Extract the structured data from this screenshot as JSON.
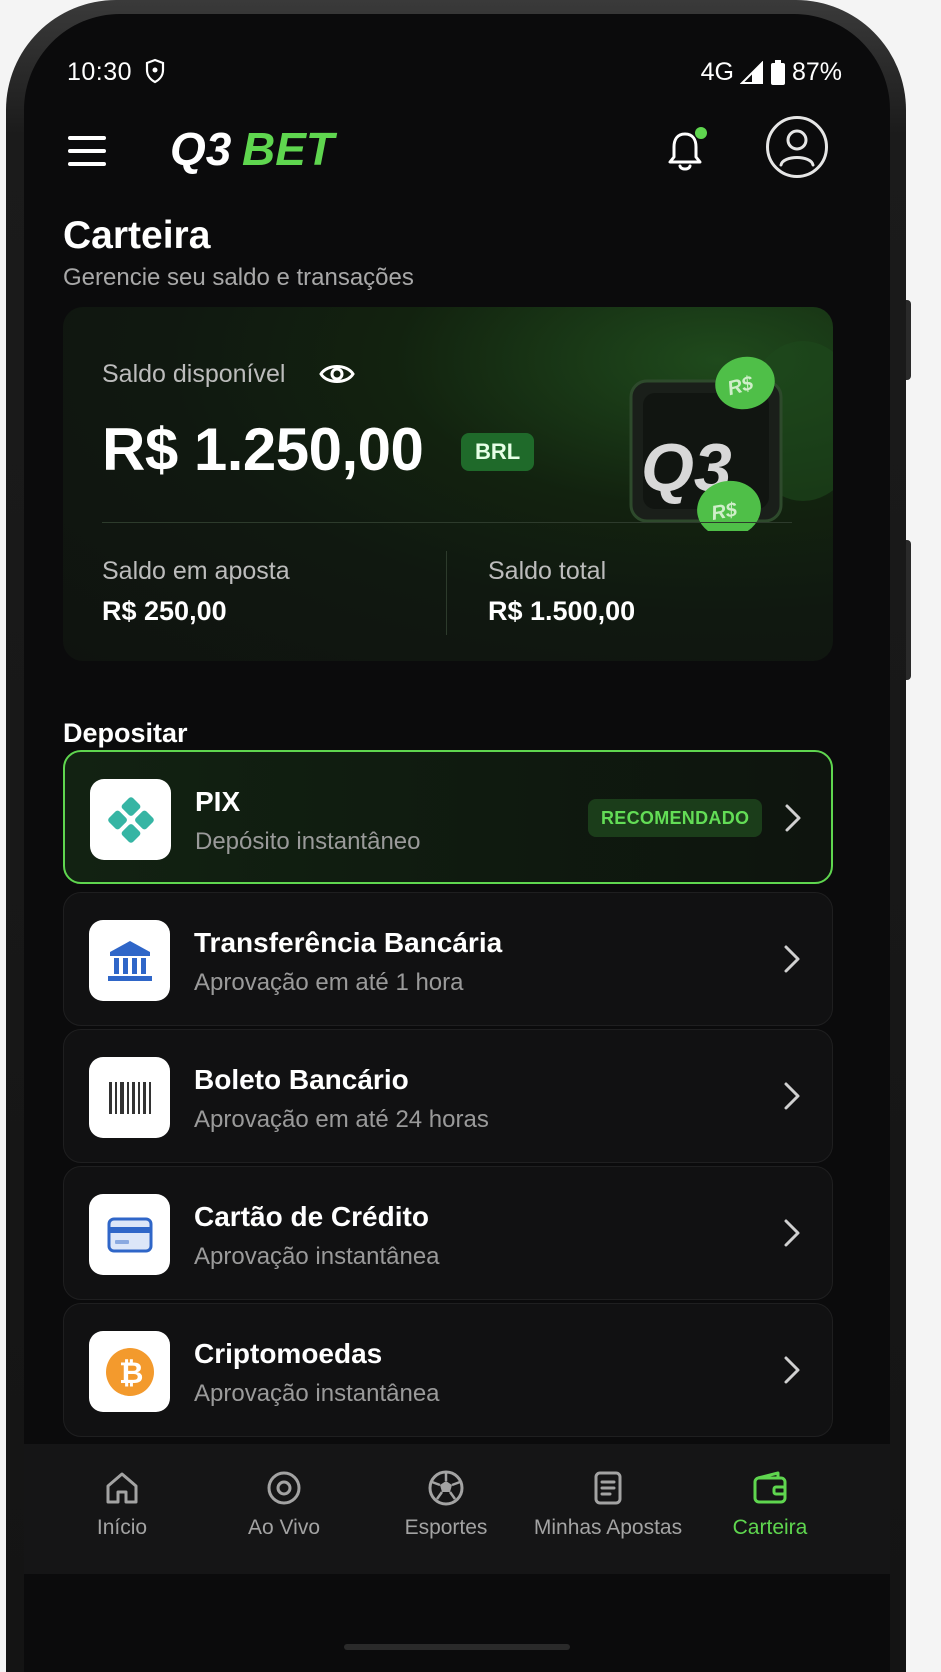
{
  "status_bar": {
    "time": "10:30",
    "network": "4G",
    "battery": "87%",
    "icons": [
      "shield-icon",
      "signal-icon",
      "battery-icon"
    ]
  },
  "header": {
    "brand": "Q3BET",
    "brand_colors": {
      "q3": "#ffffff",
      "bet": "#5fd64f"
    },
    "notification_dot": true
  },
  "page": {
    "title": "Carteira",
    "subtitle": "Gerencie seu saldo e transações"
  },
  "balance": {
    "label": "Saldo disponível",
    "value": "R$ 1.250,00",
    "currency": "BRL",
    "in_bets_label": "Saldo em aposta",
    "in_bets_value": "R$ 250,00",
    "total_label": "Saldo total",
    "total_value": "R$ 1.500,00",
    "art_text": "Q3",
    "coin_text": "R$"
  },
  "deposit": {
    "section_title": "Depositar",
    "methods": [
      {
        "title": "PIX",
        "subtitle": "Depósito instantâneo",
        "badge": "RECOMENDADO",
        "icon": "pix-icon",
        "recommended": true
      },
      {
        "title": "Transferência Bancária",
        "subtitle": "Aprovação em até 1 hora",
        "icon": "bank-icon"
      },
      {
        "title": "Boleto Bancário",
        "subtitle": "Aprovação em até 24 horas",
        "icon": "barcode-icon"
      },
      {
        "title": "Cartão de Crédito",
        "subtitle": "Aprovação instantânea",
        "icon": "credit-card-icon"
      },
      {
        "title": "Criptomoedas",
        "subtitle": "Aprovação instantânea",
        "icon": "bitcoin-icon"
      }
    ]
  },
  "nav": {
    "items": [
      {
        "label": "Início",
        "icon": "home-icon"
      },
      {
        "label": "Ao Vivo",
        "icon": "live-icon"
      },
      {
        "label": "Esportes",
        "icon": "soccer-ball-icon"
      },
      {
        "label": "Minhas Apostas",
        "icon": "bets-ticket-icon"
      },
      {
        "label": "Carteira",
        "icon": "wallet-icon",
        "active": true
      }
    ],
    "active_color": "#5fd64f"
  },
  "colors": {
    "accent": "#5fd64f",
    "background": "#0b0b0c",
    "card": "#111112"
  }
}
